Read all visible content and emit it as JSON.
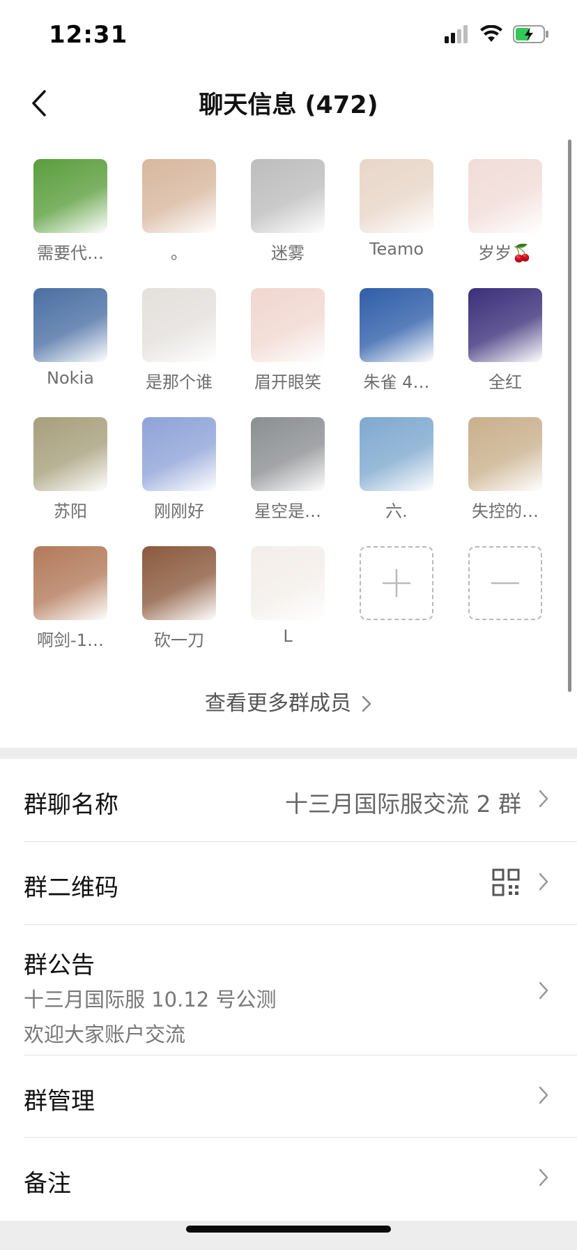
{
  "status": {
    "time": "12:31"
  },
  "header": {
    "title": "聊天信息 (472)"
  },
  "members": [
    {
      "name": "需要代…",
      "avatar": "cartoon-boy",
      "color": "#5b9e3d"
    },
    {
      "name": "。",
      "avatar": "girl-with-bear",
      "color": "#d8b79e"
    },
    {
      "name": "迷雾",
      "avatar": "shadow-silhouette",
      "color": "#bdbdbd"
    },
    {
      "name": "Teamo",
      "avatar": "anime-girl",
      "color": "#e8d6c8"
    },
    {
      "name": "岁岁🍒",
      "avatar": "girl-portrait",
      "color": "#f1dcd8"
    },
    {
      "name": "Nokia",
      "avatar": "mountain-landscape",
      "color": "#4b6fa3"
    },
    {
      "name": "是那个谁",
      "avatar": "sketch-figure",
      "color": "#e4e0dc"
    },
    {
      "name": "眉开眼笑",
      "avatar": "fruit-skewer",
      "color": "#f1d7d0"
    },
    {
      "name": "朱雀 4…",
      "avatar": "man-portrait",
      "color": "#2f5ea9"
    },
    {
      "name": "全红",
      "avatar": "anime-character-purple",
      "color": "#3c2f7a"
    },
    {
      "name": "苏阳",
      "avatar": "two-men-photo",
      "color": "#a7a07c"
    },
    {
      "name": "刚刚好",
      "avatar": "blue-hoodie",
      "color": "#8fa3d8"
    },
    {
      "name": "星空是…",
      "avatar": "anime-boy",
      "color": "#8c8f92"
    },
    {
      "name": "六.",
      "avatar": "road-photo",
      "color": "#7fa9cf"
    },
    {
      "name": "失控的…",
      "avatar": "cat-sunglasses",
      "color": "#c9b08c"
    },
    {
      "name": "啊剑-1…",
      "avatar": "dog-mirror",
      "color": "#b37a5a"
    },
    {
      "name": "砍一刀",
      "avatar": "joker-face",
      "color": "#8b5a3e"
    },
    {
      "name": "L",
      "avatar": "cartoon-boy-glasses",
      "color": "#f3eee9"
    }
  ],
  "add_member": {
    "icon": "plus-icon"
  },
  "remove_member": {
    "icon": "minus-icon"
  },
  "more_members": "查看更多群成员",
  "settings": {
    "group_name": {
      "label": "群聊名称",
      "value": "十三月国际服交流 2 群"
    },
    "qr_code": {
      "label": "群二维码",
      "icon": "qr-code-icon"
    },
    "announcement": {
      "label": "群公告",
      "line1": "十三月国际服 10.12 号公测",
      "line2": "欢迎大家账户交流"
    },
    "management": {
      "label": "群管理"
    },
    "remark": {
      "label": "备注"
    }
  }
}
